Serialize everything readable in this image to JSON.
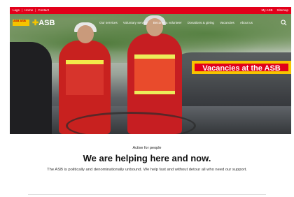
{
  "topbar": {
    "links": [
      "Lage",
      "Home",
      "Contact"
    ],
    "separator": "|",
    "right": [
      "My ASB",
      "Sitemap"
    ]
  },
  "header": {
    "logo_small_text": "ASB ASB",
    "logo_main": "ASB",
    "nav": [
      "Our services",
      "Voluntary service",
      "Become a volunteer",
      "Donations & giving",
      "Vacancies",
      "About us"
    ]
  },
  "hero": {
    "cta": "Vacancies at the ASB"
  },
  "content": {
    "eyebrow": "Active for people",
    "headline": "We are helping here and now.",
    "body": "The ASB is politically and denominationally unbound. We help fast and without detour all who need our support."
  },
  "colors": {
    "brand_red": "#e2001a",
    "brand_yellow": "#f5c400"
  },
  "icons": {
    "search": "search-icon"
  }
}
